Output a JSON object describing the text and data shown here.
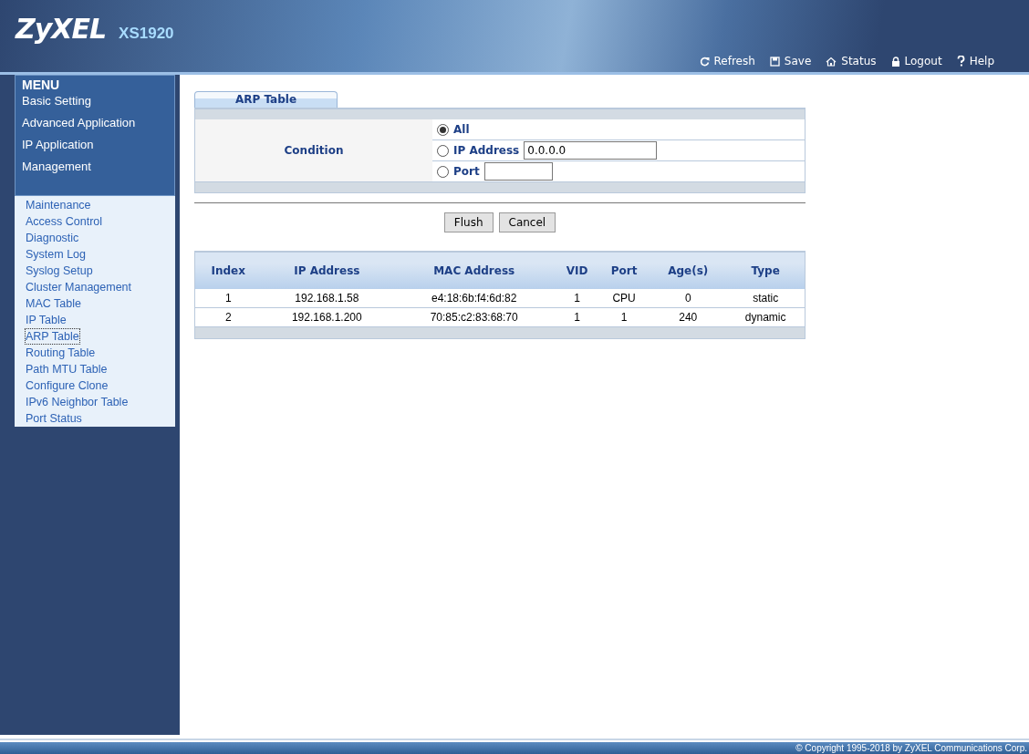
{
  "header": {
    "logo": "ZyXEL",
    "model": "XS1920",
    "links": [
      {
        "label": "Refresh",
        "kind": "refresh"
      },
      {
        "label": "Save",
        "kind": "save"
      },
      {
        "label": "Status",
        "kind": "home"
      },
      {
        "label": "Logout",
        "kind": "lock"
      },
      {
        "label": "Help",
        "kind": "help"
      }
    ]
  },
  "menu": {
    "title": "MENU",
    "sections": [
      "Basic Setting",
      "Advanced Application",
      "IP Application",
      "Management"
    ]
  },
  "submenu": [
    {
      "label": "Maintenance",
      "selected": false
    },
    {
      "label": "Access Control",
      "selected": false
    },
    {
      "label": "Diagnostic",
      "selected": false
    },
    {
      "label": "System Log",
      "selected": false
    },
    {
      "label": "Syslog Setup",
      "selected": false
    },
    {
      "label": "Cluster Management",
      "selected": false
    },
    {
      "label": "MAC Table",
      "selected": false
    },
    {
      "label": "IP Table",
      "selected": false
    },
    {
      "label": "ARP Table",
      "selected": true
    },
    {
      "label": "Routing Table",
      "selected": false
    },
    {
      "label": "Path MTU Table",
      "selected": false
    },
    {
      "label": "Configure Clone",
      "selected": false
    },
    {
      "label": "IPv6 Neighbor Table",
      "selected": false
    },
    {
      "label": "Port Status",
      "selected": false
    }
  ],
  "tab": {
    "label": "ARP Table"
  },
  "condition": {
    "label": "Condition",
    "options": [
      {
        "label": "All",
        "selected": true,
        "kind": "plain"
      },
      {
        "label": "IP Address",
        "selected": false,
        "kind": "wide-field",
        "value": "0.0.0.0"
      },
      {
        "label": "Port",
        "selected": false,
        "kind": "short-field"
      }
    ]
  },
  "buttons": [
    "Flush",
    "Cancel"
  ],
  "table": {
    "columns": [
      "Index",
      "IP Address",
      "MAC Address",
      "VID",
      "Port",
      "Age(s)",
      "Type"
    ],
    "rows": [
      [
        "1",
        "192.168.1.58",
        "e4:18:6b:f4:6d:82",
        "1",
        "CPU",
        "0",
        "static"
      ],
      [
        "2",
        "192.168.1.200",
        "70:85:c2:83:68:70",
        "1",
        "1",
        "240",
        "dynamic"
      ]
    ]
  },
  "footer": "© Copyright 1995-2018 by ZyXEL Communications Corp."
}
